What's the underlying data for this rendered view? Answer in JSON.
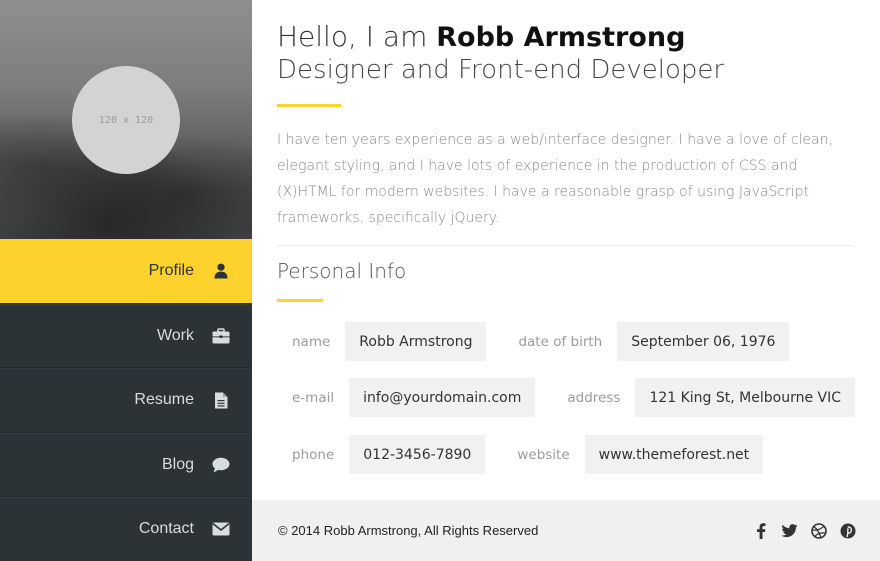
{
  "profile": {
    "avatar_placeholder": "120 x 120",
    "greeting": "Hello, I am ",
    "name": "Robb Armstrong",
    "role": "Designer and Front-end Developer",
    "bio": "I have ten years experience as a web/interface designer. I have a love of clean, elegant styling, and I have lots of experience in the production of CSS and (X)HTML for modern websites. I have a reasonable grasp of using JavaScript frameworks, specifically jQuery."
  },
  "nav": {
    "items": [
      {
        "label": "Profile",
        "icon": "user-icon"
      },
      {
        "label": "Work",
        "icon": "briefcase-icon"
      },
      {
        "label": "Resume",
        "icon": "document-icon"
      },
      {
        "label": "Blog",
        "icon": "chat-bubble-icon"
      },
      {
        "label": "Contact",
        "icon": "envelope-icon"
      }
    ],
    "active_index": 0
  },
  "personal_info": {
    "title": "Personal Info",
    "name_label": "name",
    "name_value": "Robb Armstrong",
    "dob_label": "date of birth",
    "dob_value": "September 06, 1976",
    "email_label": "e-mail",
    "email_value": "info@yourdomain.com",
    "address_label": "address",
    "address_value": "121 King St, Melbourne VIC",
    "phone_label": "phone",
    "phone_value": "012-3456-7890",
    "website_label": "website",
    "website_value": "www.themeforest.net"
  },
  "footer": {
    "copyright": "© 2014 Robb Armstrong,  All Rights Reserved",
    "socials": [
      "facebook-icon",
      "twitter-icon",
      "dribbble-icon",
      "pinterest-icon"
    ]
  },
  "colors": {
    "accent": "#fdd22d",
    "sidebar": "#2b3337",
    "footer": "#f0f0f0"
  }
}
